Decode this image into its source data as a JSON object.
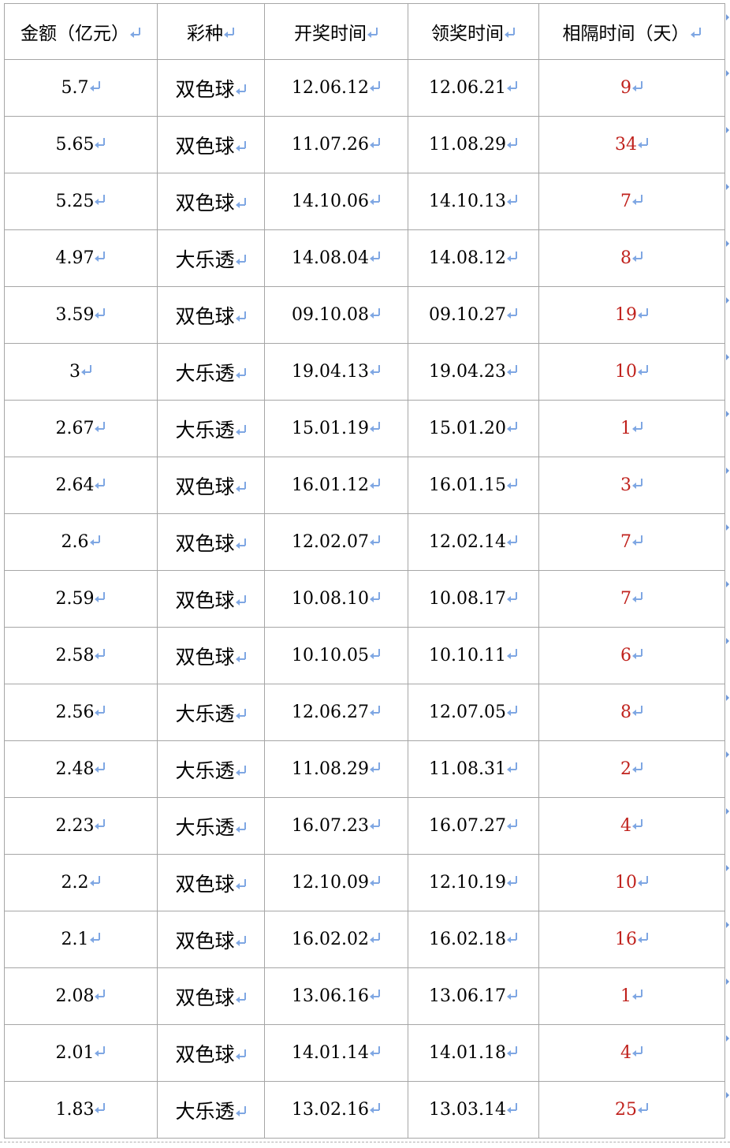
{
  "table": {
    "headers": [
      "金额（亿元）",
      "彩种",
      "开奖时间",
      "领奖时间",
      "相隔时间（天）"
    ],
    "rows": [
      [
        "5.7",
        "双色球",
        "12.06.12",
        "12.06.21",
        "9"
      ],
      [
        "5.65",
        "双色球",
        "11.07.26",
        "11.08.29",
        "34"
      ],
      [
        "5.25",
        "双色球",
        "14.10.06",
        "14.10.13",
        "7"
      ],
      [
        "4.97",
        "大乐透",
        "14.08.04",
        "14.08.12",
        "8"
      ],
      [
        "3.59",
        "双色球",
        "09.10.08",
        "09.10.27",
        "19"
      ],
      [
        "3",
        "大乐透",
        "19.04.13",
        "19.04.23",
        "10"
      ],
      [
        "2.67",
        "大乐透",
        "15.01.19",
        "15.01.20",
        "1"
      ],
      [
        "2.64",
        "双色球",
        "16.01.12",
        "16.01.15",
        "3"
      ],
      [
        "2.6",
        "双色球",
        "12.02.07",
        "12.02.14",
        "7"
      ],
      [
        "2.59",
        "双色球",
        "10.08.10",
        "10.08.17",
        "7"
      ],
      [
        "2.58",
        "双色球",
        "10.10.05",
        "10.10.11",
        "6"
      ],
      [
        "2.56",
        "大乐透",
        "12.06.27",
        "12.07.05",
        "8"
      ],
      [
        "2.48",
        "大乐透",
        "11.08.29",
        "11.08.31",
        "2"
      ],
      [
        "2.23",
        "大乐透",
        "16.07.23",
        "16.07.27",
        "4"
      ],
      [
        "2.2",
        "双色球",
        "12.10.09",
        "12.10.19",
        "10"
      ],
      [
        "2.1",
        "双色球",
        "16.02.02",
        "16.02.18",
        "16"
      ],
      [
        "2.08",
        "双色球",
        "13.06.16",
        "13.06.17",
        "1"
      ],
      [
        "2.01",
        "双色球",
        "14.01.14",
        "14.01.18",
        "4"
      ],
      [
        "1.83",
        "大乐透",
        "13.02.16",
        "13.03.14",
        "25"
      ]
    ]
  },
  "colors": {
    "days_text": "#c0221d",
    "paragraph_mark": "#7fa7e3",
    "border": "#a6a6a6"
  },
  "icons": {
    "cell_end_mark": "paragraph-return-icon",
    "row_end_mark": "row-end-marker-icon"
  }
}
